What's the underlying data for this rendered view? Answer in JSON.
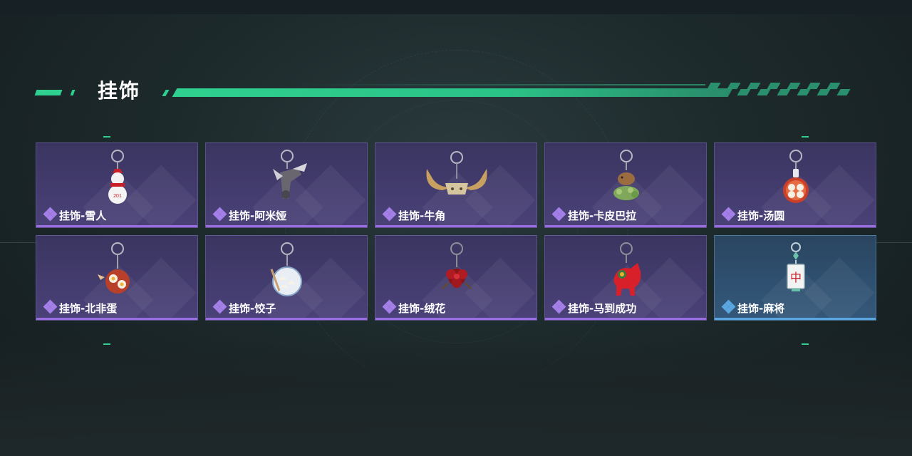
{
  "section": {
    "title": "挂饰"
  },
  "colors": {
    "accent": "#2fd08f",
    "purple_rarity": "#9a6ee0",
    "blue_rarity": "#5aa6e0"
  },
  "items": [
    {
      "label": "挂饰-雪人",
      "rarity": "purple",
      "icon": "snowman-charm-icon"
    },
    {
      "label": "挂饰-阿米娅",
      "rarity": "purple",
      "icon": "amiya-charm-icon"
    },
    {
      "label": "挂饰-牛角",
      "rarity": "purple",
      "icon": "bull-horn-charm-icon"
    },
    {
      "label": "挂饰-卡皮巴拉",
      "rarity": "purple",
      "icon": "capybara-charm-icon"
    },
    {
      "label": "挂饰-汤圆",
      "rarity": "purple",
      "icon": "tangyuan-charm-icon"
    },
    {
      "label": "挂饰-北非蛋",
      "rarity": "purple",
      "icon": "shakshuka-charm-icon"
    },
    {
      "label": "挂饰-饺子",
      "rarity": "purple",
      "icon": "dumpling-charm-icon"
    },
    {
      "label": "挂饰-绒花",
      "rarity": "purple",
      "icon": "velvet-flower-charm-icon"
    },
    {
      "label": "挂饰-马到成功",
      "rarity": "purple",
      "icon": "horse-charm-icon"
    },
    {
      "label": "挂饰-麻将",
      "rarity": "blue",
      "icon": "mahjong-charm-icon"
    }
  ]
}
